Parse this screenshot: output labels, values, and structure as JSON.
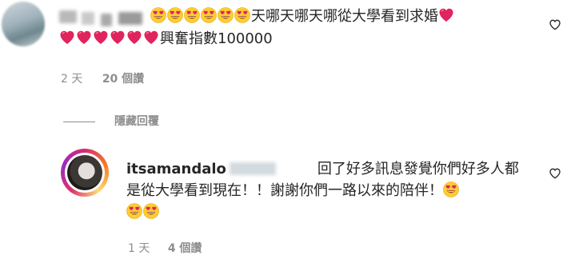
{
  "comment1": {
    "text": "天哪天哪天哪從大學看到求婚",
    "text_line2": "興奮指數100000",
    "time": "2 天",
    "likes": "20 個讚"
  },
  "replies_toggle": "隱藏回覆",
  "reply1": {
    "username": "itsamandalo",
    "text_line1": "回了好多訊息發覺你們好多人都",
    "text_line2": "是從大學看到現在！！謝謝你們一路以來的陪伴！",
    "time": "1 天",
    "likes": "4 個讚"
  },
  "icons": {
    "emoji": "heart-eyes-emoji",
    "heart": "red-heart-emoji",
    "like": "heart-outline-icon"
  },
  "colors": {
    "text": "#262626",
    "meta": "#8e8e8e",
    "heart_red": "#e0245e",
    "emoji_yellow": "#ffcc33"
  }
}
